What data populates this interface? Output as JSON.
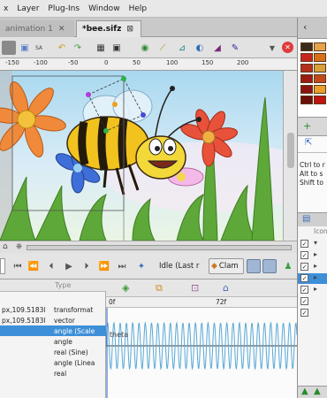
{
  "menubar": {
    "items": [
      "x",
      "Layer",
      "Plug-Ins",
      "Window",
      "Help"
    ]
  },
  "tabs": [
    {
      "label": "animation 1",
      "active": false
    },
    {
      "label": "*bee.sifz",
      "active": true
    }
  ],
  "ruler": {
    "ticks": [
      "-150",
      "-100",
      "-50",
      "0",
      "50",
      "100",
      "150",
      "200"
    ]
  },
  "playbar": {
    "state_label": "Idle (Last r",
    "clamp_label": "Clam"
  },
  "params": {
    "header": "Type",
    "rows": [
      {
        "value": "px,109.5183l",
        "type": "transformat",
        "selected": false
      },
      {
        "value": "px,109.5183l",
        "type": "vector",
        "selected": false
      },
      {
        "value": "",
        "type": "angle (Scale",
        "selected": true
      },
      {
        "value": "",
        "type": "angle",
        "selected": false
      },
      {
        "value": "",
        "type": "real (Sine)",
        "selected": false
      },
      {
        "value": "",
        "type": "angle (Linea",
        "selected": false
      },
      {
        "value": "",
        "type": "real",
        "selected": false
      }
    ]
  },
  "curves": {
    "frame_start": "0f",
    "frame_mid": "72f",
    "label": "theta"
  },
  "rightpanel": {
    "ctrl_hint": "Ctrl to r",
    "alt_hint": "Alt to s",
    "shift_hint": "Shift to",
    "layers_header": "Icon"
  },
  "colors": {
    "accent": "#3a8ee6",
    "selection": "#3d8fd8",
    "wave": "#5aa9d6",
    "canvas_bg": "#ffffff"
  }
}
